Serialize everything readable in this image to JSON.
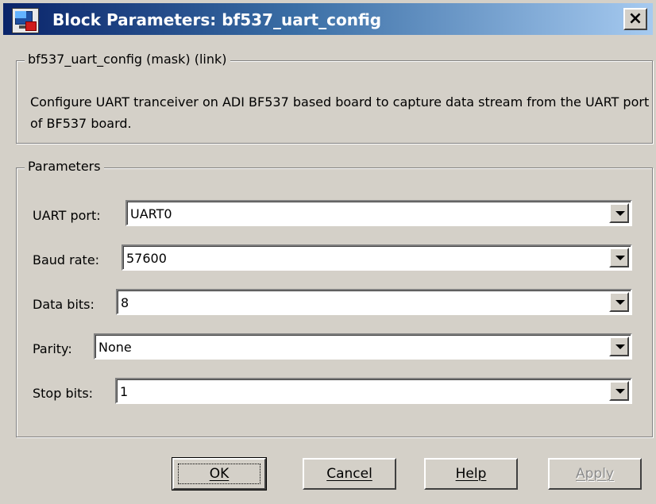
{
  "window": {
    "title": "Block Parameters: bf537_uart_config",
    "close_label": "×"
  },
  "mask_group": {
    "legend": "bf537_uart_config (mask) (link)",
    "description": "Configure UART tranceiver on ADI BF537 based board to capture data stream from the UART port of BF537 board."
  },
  "parameters_group": {
    "legend": "Parameters",
    "fields": [
      {
        "label": "UART port:",
        "value": "UART0"
      },
      {
        "label": "Baud rate:",
        "value": "57600"
      },
      {
        "label": "Data bits:",
        "value": "8"
      },
      {
        "label": "Parity:",
        "value": "None"
      },
      {
        "label": "Stop bits:",
        "value": "1"
      }
    ]
  },
  "buttons": {
    "ok": "OK",
    "cancel": "Cancel",
    "help": "Help",
    "apply": "Apply"
  },
  "colors": {
    "title_gradient_start": "#0a246a",
    "title_gradient_end": "#a6caf0",
    "dialog_face": "#d4d0c8"
  },
  "icons": {
    "app": "simulink-block-icon",
    "close": "close-icon",
    "dropdown": "dropdown-arrow-icon"
  }
}
